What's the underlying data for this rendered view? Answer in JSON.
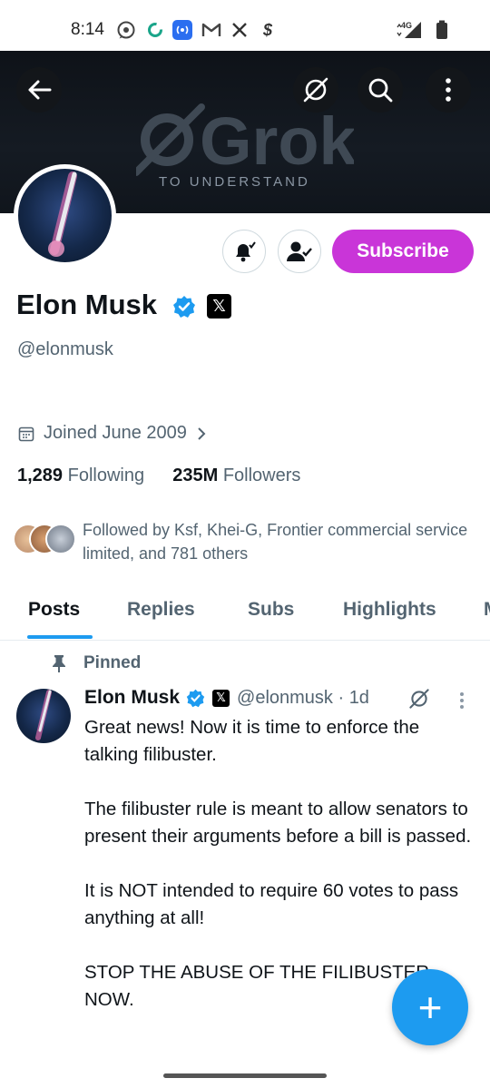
{
  "status_bar": {
    "time": "8:14",
    "network": "4G",
    "icons": [
      "whatsapp-icon",
      "circle-app-icon",
      "radio-icon",
      "gmail-icon",
      "x-app-icon",
      "cash-icon",
      "signal-icon",
      "battery-icon"
    ]
  },
  "banner": {
    "logo_text": "Grok",
    "tagline": "TO UNDERSTAND"
  },
  "profile": {
    "name": "Elon Musk",
    "handle": "@elonmusk",
    "joined": "Joined June 2009",
    "following_count": "1,289",
    "following_label": "Following",
    "followers_count": "235M",
    "followers_label": "Followers",
    "followed_by": "Followed by Ksf, Khei-G, Frontier commercial service limited, and 781 others",
    "subscribe_label": "Subscribe"
  },
  "tabs": [
    "Posts",
    "Replies",
    "Subs",
    "Highlights",
    "M"
  ],
  "post": {
    "pinned_label": "Pinned",
    "author_name": "Elon Musk",
    "author_handle": "@elonmusk · 1d",
    "body": "Great news! Now it is time to enforce the talking filibuster.\n\nThe filibuster rule is meant to allow senators to present their arguments before a bill is passed.\n\nIt is NOT intended to require 60 votes to pass anything at all!\n\nSTOP THE ABUSE OF THE FILIBUSTER NOW."
  },
  "fab": {
    "label": "+"
  },
  "colors": {
    "accent": "#1d9bf0",
    "subscribe": "#c935d8",
    "muted_text": "#536471"
  }
}
